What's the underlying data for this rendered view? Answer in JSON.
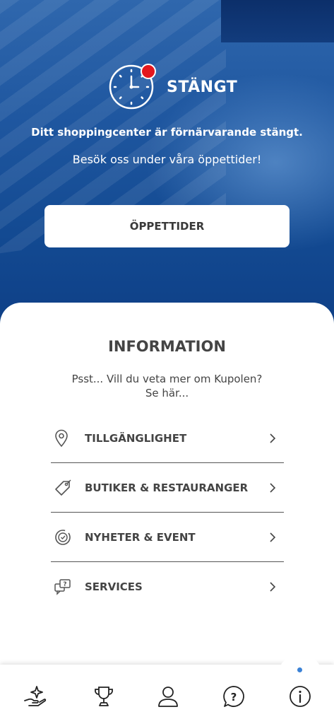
{
  "status": {
    "label": "STÄNGT",
    "indicator_color": "#e3171e",
    "icon": "clock-icon"
  },
  "hero": {
    "closed_message": "Ditt shoppingcenter är förnärvarande stängt.",
    "visit_message": "Besök oss under våra öppettider!",
    "hours_button_label": "ÖPPETTIDER"
  },
  "info": {
    "title": "INFORMATION",
    "subtitle_line1": "Psst... Vill du veta mer om Kupolen?",
    "subtitle_line2": "Se här...",
    "items": [
      {
        "label": "TILLGÄNGLIGHET",
        "icon": "location-pin-icon"
      },
      {
        "label": "BUTIKER & RESTAURANGER",
        "icon": "tag-icon"
      },
      {
        "label": "NYHETER & EVENT",
        "icon": "news-icon"
      },
      {
        "label": "SERVICES",
        "icon": "chat-question-icon"
      }
    ]
  },
  "tabbar": {
    "tabs": [
      {
        "icon": "sparkle-hand-icon"
      },
      {
        "icon": "trophy-icon"
      },
      {
        "icon": "user-icon"
      },
      {
        "icon": "question-icon"
      },
      {
        "icon": "info-icon",
        "active": true
      }
    ],
    "active_color": "#3b82d6"
  }
}
